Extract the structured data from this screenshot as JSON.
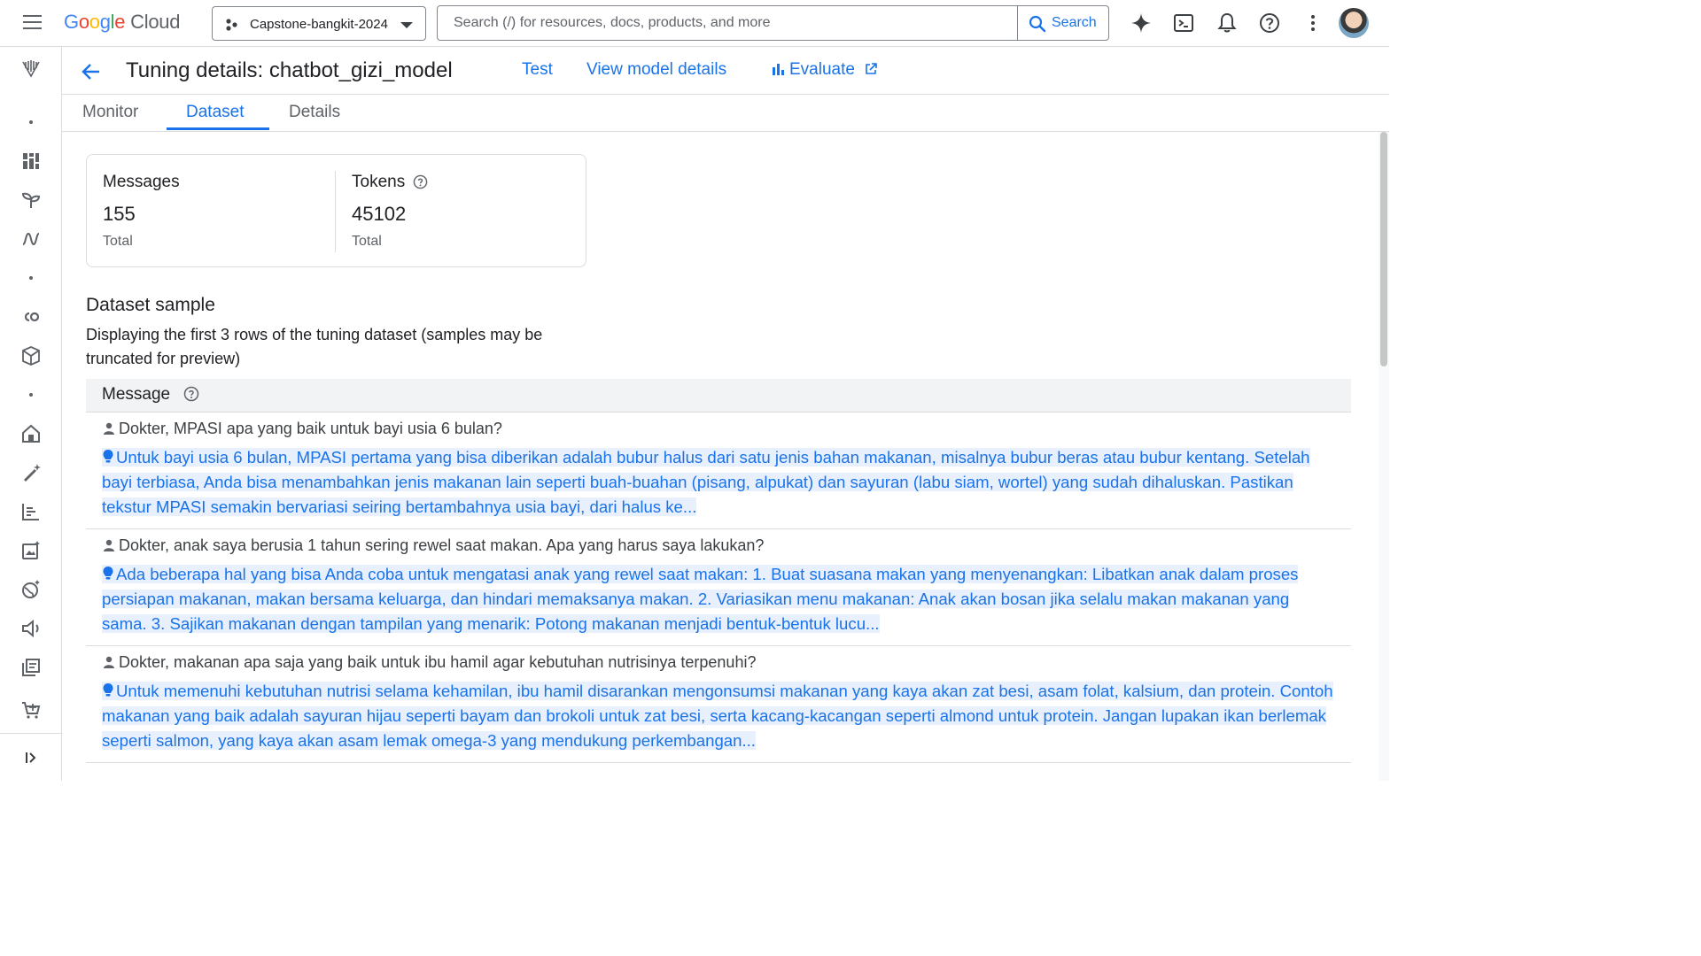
{
  "topbar": {
    "logo_google": [
      "G",
      "o",
      "o",
      "g",
      "l",
      "e"
    ],
    "logo_cloud": "Cloud",
    "project_name": "Capstone-bangkit-2024",
    "search_placeholder": "Search (/) for resources, docs, products, and more",
    "search_button": "Search",
    "icons": [
      "menu-icon",
      "gemini-icon",
      "cloud-shell-icon",
      "notifications-icon",
      "help-icon",
      "more-vert-icon",
      "avatar"
    ]
  },
  "rail": {
    "icons": [
      "vertex-ai-icon",
      "dashboard-icon",
      "model-garden-icon",
      "pipelines-icon",
      "colab-icon",
      "marketplace-icon",
      "home-icon",
      "prompt-design-icon",
      "tuning-icon",
      "image-edit-icon",
      "language-icon",
      "speech-icon",
      "library-icon",
      "shop-icon",
      "expand-icon"
    ]
  },
  "header": {
    "title": "Tuning details: chatbot_gizi_model",
    "test_link": "Test",
    "view_model_link": "View model details",
    "evaluate_link": "Evaluate"
  },
  "tabs": [
    {
      "label": "Monitor",
      "active": false
    },
    {
      "label": "Dataset",
      "active": true
    },
    {
      "label": "Details",
      "active": false
    }
  ],
  "stats": {
    "messages": {
      "label": "Messages",
      "value": "155",
      "sub": "Total"
    },
    "tokens": {
      "label": "Tokens",
      "value": "45102",
      "sub": "Total"
    }
  },
  "dataset_sample": {
    "title": "Dataset sample",
    "description": "Displaying the first 3 rows of the tuning dataset (samples may be truncated for preview)",
    "column_header": "Message",
    "rows": [
      {
        "question": "Dokter, MPASI apa yang baik untuk bayi usia 6 bulan?",
        "answer": "Untuk bayi usia 6 bulan, MPASI pertama yang bisa diberikan adalah bubur halus dari satu jenis bahan makanan, misalnya bubur beras atau bubur kentang. Setelah bayi terbiasa, Anda bisa menambahkan jenis makanan lain seperti buah-buahan (pisang, alpukat) dan sayuran (labu siam, wortel) yang sudah dihaluskan. Pastikan tekstur MPASI semakin bervariasi seiring bertambahnya usia bayi, dari halus ke..."
      },
      {
        "question": "Dokter, anak saya berusia 1 tahun sering rewel saat makan. Apa yang harus saya lakukan?",
        "answer": "Ada beberapa hal yang bisa Anda coba untuk mengatasi anak yang rewel saat makan: 1. Buat suasana makan yang menyenangkan: Libatkan anak dalam proses persiapan makanan, makan bersama keluarga, dan hindari memaksanya makan. 2. Variasikan menu makanan: Anak akan bosan jika selalu makan makanan yang sama. 3. Sajikan makanan dengan tampilan yang menarik: Potong makanan menjadi bentuk-bentuk lucu..."
      },
      {
        "question": "Dokter, makanan apa saja yang baik untuk ibu hamil agar kebutuhan nutrisinya terpenuhi?",
        "answer": "Untuk memenuhi kebutuhan nutrisi selama kehamilan, ibu hamil disarankan mengonsumsi makanan yang kaya akan zat besi, asam folat, kalsium, dan protein. Contoh makanan yang baik adalah sayuran hijau seperti bayam dan brokoli untuk zat besi, serta kacang-kacangan seperti almond untuk protein. Jangan lupakan ikan berlemak seperti salmon, yang kaya akan asam lemak omega-3 yang mendukung perkembangan..."
      }
    ]
  },
  "colors": {
    "accent": "#1a73e8",
    "highlight": "#e8f0fe",
    "border": "#dadce0",
    "text": "#202124",
    "muted": "#5f6368"
  }
}
